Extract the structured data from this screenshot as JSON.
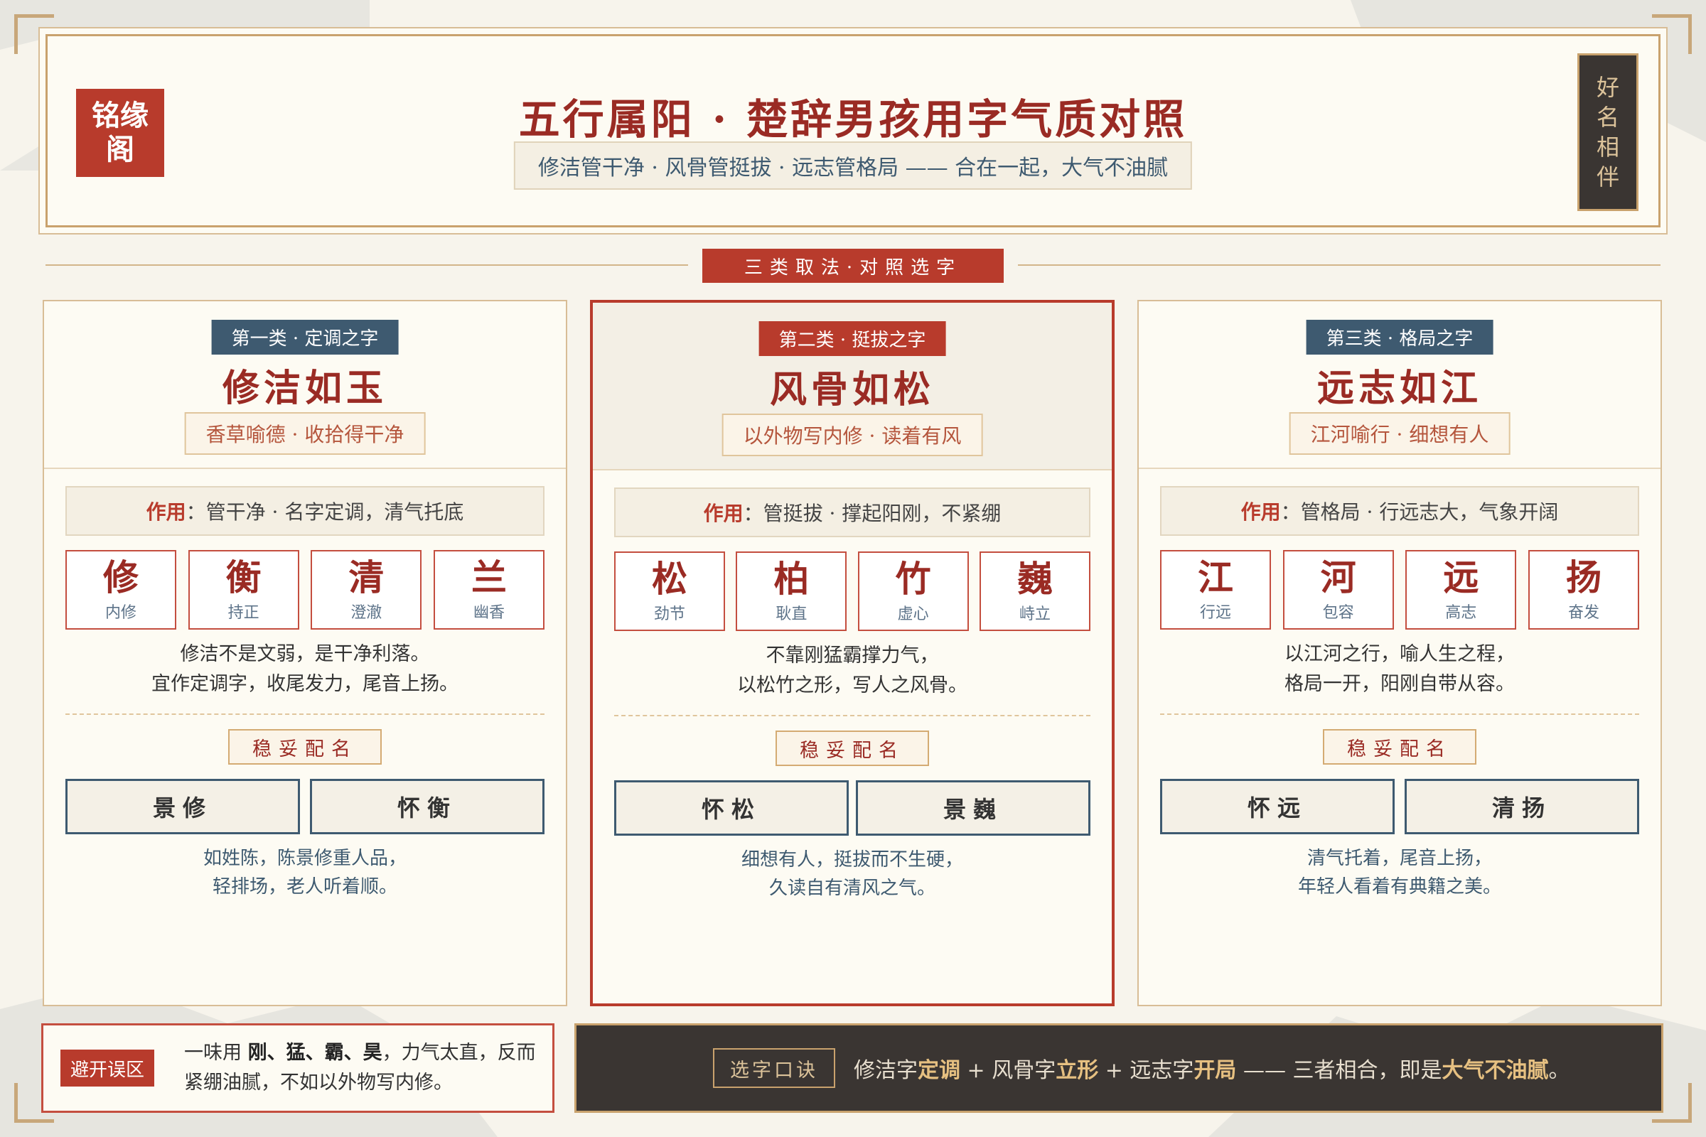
{
  "brand": {
    "logo_text": "铭缘阁",
    "seal_text": "好名相伴"
  },
  "header": {
    "title": "五行属阳 · 楚辞男孩用字气质对照",
    "subtitle": "修洁管干净 · 风骨管挺拔 · 远志管格局 —— 合在一起，大气不油腻"
  },
  "section_label": "三类取法·对照选字",
  "colors": {
    "accent_red": "#b83b2c",
    "dark_red": "#9a2b24",
    "slate_blue": "#3e5a70",
    "gold": "#c9a26d",
    "dark_bg": "#3a3532",
    "paper": "#fdfbf3"
  },
  "columns": [
    {
      "category": "第一类 · 定调之字",
      "title": "修洁如玉",
      "subtitle": "香草喻德 · 收拾得干净",
      "func_label": "作用",
      "func_text": "：管干净 · 名字定调，清气托底",
      "chars": [
        {
          "char": "修",
          "meaning": "内修"
        },
        {
          "char": "衡",
          "meaning": "持正"
        },
        {
          "char": "清",
          "meaning": "澄澈"
        },
        {
          "char": "兰",
          "meaning": "幽香"
        }
      ],
      "desc": [
        "修洁不是文弱，是干净利落。",
        "宜作定调字，收尾发力，尾音上扬。"
      ],
      "safe_label": "稳妥配名",
      "names": [
        "景修",
        "怀衡"
      ],
      "note": [
        "如姓陈，陈景修重人品，",
        "轻排场，老人听着顺。"
      ]
    },
    {
      "category": "第二类 · 挺拔之字",
      "title": "风骨如松",
      "subtitle": "以外物写内修 · 读着有风",
      "func_label": "作用",
      "func_text": "：管挺拔 · 撑起阳刚，不紧绷",
      "chars": [
        {
          "char": "松",
          "meaning": "劲节"
        },
        {
          "char": "柏",
          "meaning": "耿直"
        },
        {
          "char": "竹",
          "meaning": "虚心"
        },
        {
          "char": "巍",
          "meaning": "峙立"
        }
      ],
      "desc": [
        "不靠刚猛霸撑力气，",
        "以松竹之形，写人之风骨。"
      ],
      "safe_label": "稳妥配名",
      "names": [
        "怀松",
        "景巍"
      ],
      "note": [
        "细想有人，挺拔而不生硬，",
        "久读自有清风之气。"
      ]
    },
    {
      "category": "第三类 · 格局之字",
      "title": "远志如江",
      "subtitle": "江河喻行 · 细想有人",
      "func_label": "作用",
      "func_text": "：管格局 · 行远志大，气象开阔",
      "chars": [
        {
          "char": "江",
          "meaning": "行远"
        },
        {
          "char": "河",
          "meaning": "包容"
        },
        {
          "char": "远",
          "meaning": "高志"
        },
        {
          "char": "扬",
          "meaning": "奋发"
        }
      ],
      "desc": [
        "以江河之行，喻人生之程，",
        "格局一开，阳刚自带从容。"
      ],
      "safe_label": "稳妥配名",
      "names": [
        "怀远",
        "清扬"
      ],
      "note": [
        "清气托着，尾音上扬，",
        "年轻人看着有典籍之美。"
      ]
    }
  ],
  "avoid": {
    "tag": "避开误区",
    "prefix": "一味用 ",
    "bold": "刚、猛、霸、昊",
    "suffix": "，力气太直，反而",
    "line2": "紧绷油腻，不如以外物写内修。"
  },
  "tips": {
    "tag": "选字口诀",
    "t1": "修洁字",
    "h1": "定调",
    "t2": " + 风骨字",
    "h2": "立形",
    "t3": " + 远志字",
    "h3": "开局",
    "t4": " —— 三者相合，即是",
    "h4": "大气不油腻",
    "t5": "。"
  }
}
